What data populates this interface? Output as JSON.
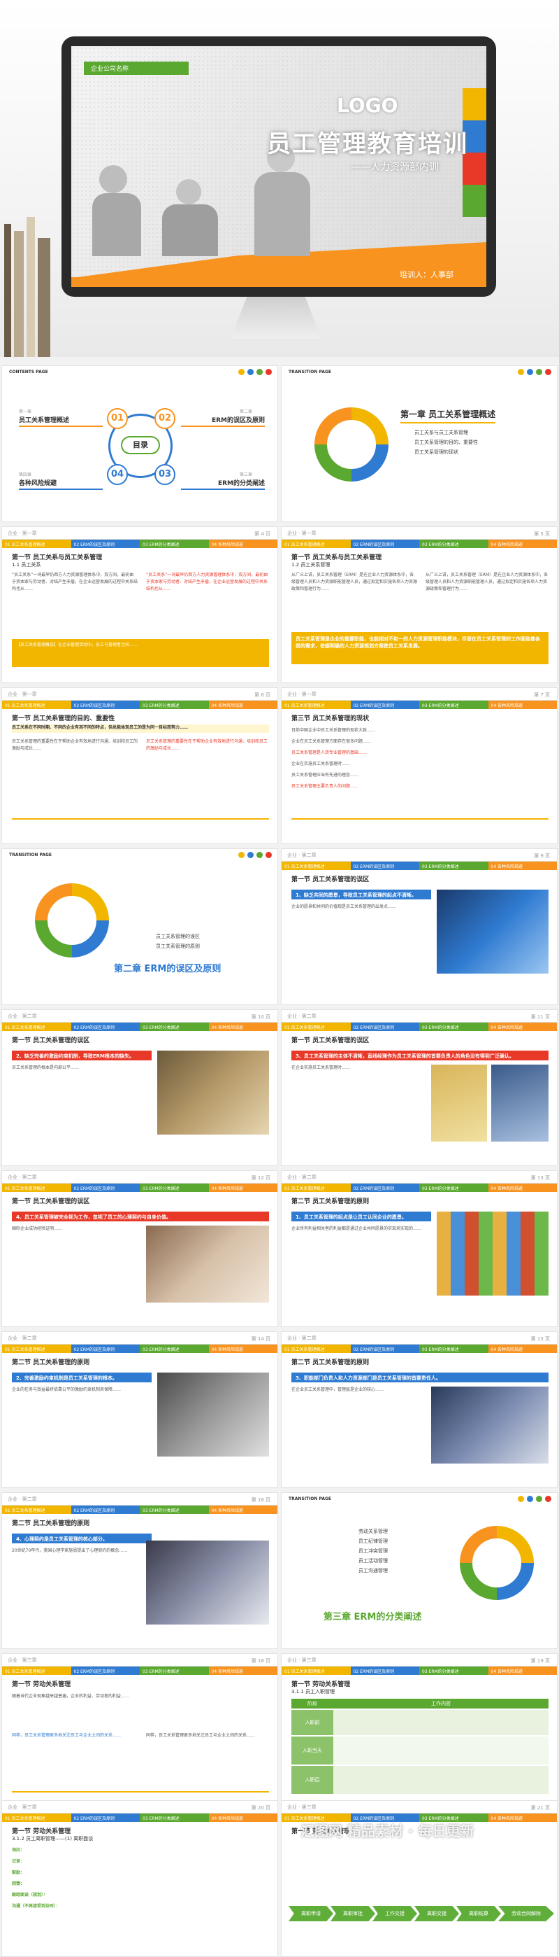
{
  "hero": {
    "company": "企业公司名称",
    "logo": "LOGO",
    "title": "员工管理教育培训",
    "subtitle": "——人力资源部内训",
    "trainer": "培训人：人事部"
  },
  "header_crumbs": {
    "c1": "企业 · 第一章",
    "c2": "企业 · 第二章",
    "c3": "企业 · 第三章"
  },
  "tabs": [
    "01 员工关系管理概述",
    "02 ERM的误区及原则",
    "03 ERM的分类阐述",
    "04 各种风险规避"
  ],
  "tabs2": [
    "01 员工关系管理概述",
    "02 ERM的误区及原则",
    "03 ERM的分类阐述",
    "04 各种风险规避"
  ],
  "contents": {
    "tag": "CONTENTS PAGE",
    "center": "目录",
    "items": [
      {
        "num": "01",
        "ch": "第一章",
        "label": "员工关系管理概述"
      },
      {
        "num": "02",
        "ch": "第二章",
        "label": "ERM的误区及原则"
      },
      {
        "num": "03",
        "ch": "第三章",
        "label": "ERM的分类阐述"
      },
      {
        "num": "04",
        "ch": "第四章",
        "label": "各种风险规避"
      }
    ]
  },
  "trans1": {
    "tag": "TRANSITION PAGE",
    "title": "第一章  员工关系管理概述",
    "bullets": [
      "员工关系与员工关系管理",
      "员工关系管理的目的、重要性",
      "员工关系管理的现状"
    ]
  },
  "trans2": {
    "tag": "TRANSITION PAGE",
    "title": "第二章  ERM的误区及原则",
    "bullets": [
      "员工关系管理的误区",
      "员工关系管理的原则"
    ]
  },
  "trans3": {
    "tag": "TRANSITION PAGE",
    "title": "第三章  ERM的分类阐述",
    "bullets": [
      "劳动关系管理",
      "员工纪律管理",
      "员工冲突管理",
      "员工活动管理",
      "员工沟通管理"
    ]
  },
  "pages": {
    "p4": {
      "pn": "第 4 页",
      "sec": "第一节  员工关系与员工关系管理",
      "sub": "1.1 员工关系",
      "text": "“员工关系”一词最早仍西方人力资源管理体系中，双方间，最初由于资本家与劳动者、对结产生矛盾，在企业运营发展的过程中关系结构也从……",
      "box": "【员工关系管理概念】在企业管理活动中，员工与管理者之间……"
    },
    "p5": {
      "pn": "第 5 页",
      "sec": "第一节  员工关系与员工关系管理",
      "sub": "1.2 员工关系管理",
      "text": "从广义上讲，员工关系管理（ERM）是在企业人力资源体系中，各级管理人员和人力资源职能管理人员，通过拟定和实施各项人力资源政策和管理行为……",
      "box": "员工关系管理是企业的重要职能，也能相对不和一的人力资源管理职能模块，尽管在员工关系管理的工作面临着各类的需求，依据明确的人力资源规划方案使员工关系发展。"
    },
    "p6": {
      "pn": "第 6 页",
      "sec": "第一节  员工关系管理的目的、重要性",
      "text": "员工关系在不同时期、不同的企业有其不同的特点，但总能体现员工的是为同一目标而努力……",
      "box": "员工关系管理的重要性在于帮助企业有效地进行沟通、培训和员工的激励与成长……"
    },
    "p7": {
      "pn": "第 7 页",
      "sec": "第三节  员工关系管理的现状",
      "items": [
        "日前中国企业中员工关系管理的现状大致……",
        "企业在员工关系管理方面存在很多问题……",
        "员工关系管理是人资专业管理的基础……",
        "企业在实施员工关系管理时……",
        "员工关系管理应当有先进的理念……",
        "员工关系管理主要负责人的问题……"
      ]
    },
    "p9": {
      "pn": "第 9 页",
      "sec": "第一节  员工关系管理的误区",
      "bar": "1、缺乏共同的愿景，导致员工关系管理的起点不清晰。",
      "text": "企业的愿景和共同的价值观是员工关系管理的出发点……"
    },
    "p10": {
      "pn": "第 10 页",
      "sec": "第一节  员工关系管理的误区",
      "bar": "2、缺乏完善的激励约束机制，导致ERM根本的缺失。",
      "text": "员工关系管理的根本是内部公平……"
    },
    "p11": {
      "pn": "第 11 页",
      "sec": "第一节  员工关系管理的误区",
      "bar": "3、员工关系管理的主体不清晰，直线经理作为员工关系管理的首要负责人的角色没有得到广泛确认。",
      "text": "在企业实施员工关系管理时……"
    },
    "p12": {
      "pn": "第 12 页",
      "sec": "第一节  员工关系管理的误区",
      "bar": "4、员工关系管理被完全视为工作，忽视了员工的心理契约与自身价值。",
      "text": "国际企业成功经验证明……"
    },
    "p13": {
      "pn": "第 13 页",
      "sec": "第二节  员工关系管理的原则",
      "bar": "1、员工关系管理的起点是让员工认同企业的愿景。",
      "text": "企业所有利益相关者的利益都是通过企业共同愿景的实现来实现的……"
    },
    "p14": {
      "pn": "第 14 页",
      "sec": "第二节  员工关系管理的原则",
      "bar": "2、完善激励约束机制是员工关系管理的根本。",
      "text": "企业的任务与效益最终依靠公平的激励约束机制来保障……"
    },
    "p15": {
      "pn": "第 15 页",
      "sec": "第二节  员工关系管理的原则",
      "bar": "3、职能部门负责人和人力资源部门是员工关系管理的首要责任人。",
      "text": "在企业员工关系管理中，管理层是企业的核心……"
    },
    "p16": {
      "pn": "第 16 页",
      "sec": "第二节  员工关系管理的原则",
      "bar": "4、心理契约是员工关系管理的核心部分。",
      "text": "20世纪70年代，美国心理学家施恩提出了心理契约的概念……"
    },
    "p18": {
      "pn": "第 18 页",
      "sec": "第一节  劳动关系管理",
      "text": "随着当代企业现象越来越普遍，企业的利益、劳动者的利益……",
      "text2": "同样，员工关系管理更多地关注员工与企业之间的关系……"
    },
    "p19": {
      "pn": "第 19 页",
      "sec": "第一节  劳动关系管理",
      "sub": "3.1.1 员工入职管理",
      "table_head": [
        "阶段",
        "工作内容"
      ],
      "rows": [
        "入职前",
        "入职当天",
        "入职后"
      ]
    },
    "p20": {
      "pn": "第 20 页",
      "sec": "第一节  劳动关系管理",
      "sub": "3.1.2 员工离职管理——(1) 离职面谈",
      "items": [
        "询问：",
        "记录：",
        "鼓励：",
        "回馈：",
        "跟踪面谈（规划）：",
        "沟通（不再接受到访时）："
      ]
    },
    "p21": {
      "pn": "第 21 页",
      "sec": "第一节  劳动关系管理",
      "flow": [
        "离职申请",
        "离职审批",
        "工作交接",
        "离职交接",
        "离职结算",
        "劳动合同解除"
      ]
    }
  },
  "watermark": "汇图网 精品素材 · 每日更新"
}
